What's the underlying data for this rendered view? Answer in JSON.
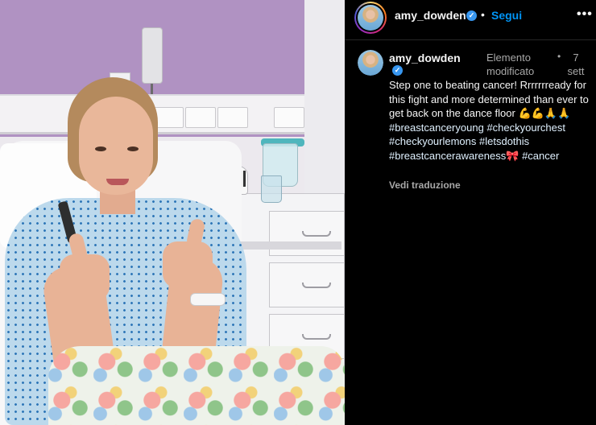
{
  "header": {
    "username": "amy_dowden",
    "verified_icon": "verified-badge-icon",
    "separator": "•",
    "follow_label": "Segui",
    "more_label": "•••"
  },
  "post_image": {
    "icon": "post-photo"
  },
  "caption": {
    "username": "amy_dowden",
    "edited_label": "Elemento modificato",
    "separator": "•",
    "time": "7 sett",
    "text": "Step one to beating cancer! Rrrrrrready for this fight and more determined than ever to get back on the dance floor 💪💪🙏🙏",
    "hashtags": [
      "#breastcanceryoung",
      "#checkyourchest",
      "#checkyourlemons",
      "#letsdothis",
      "#breastcancerawareness🎀",
      "#cancer"
    ],
    "translate_label": "Vedi traduzione"
  },
  "colors": {
    "background": "#000000",
    "follow": "#0095f6",
    "verified": "#3897f0",
    "muted": "#a8a8a8"
  }
}
